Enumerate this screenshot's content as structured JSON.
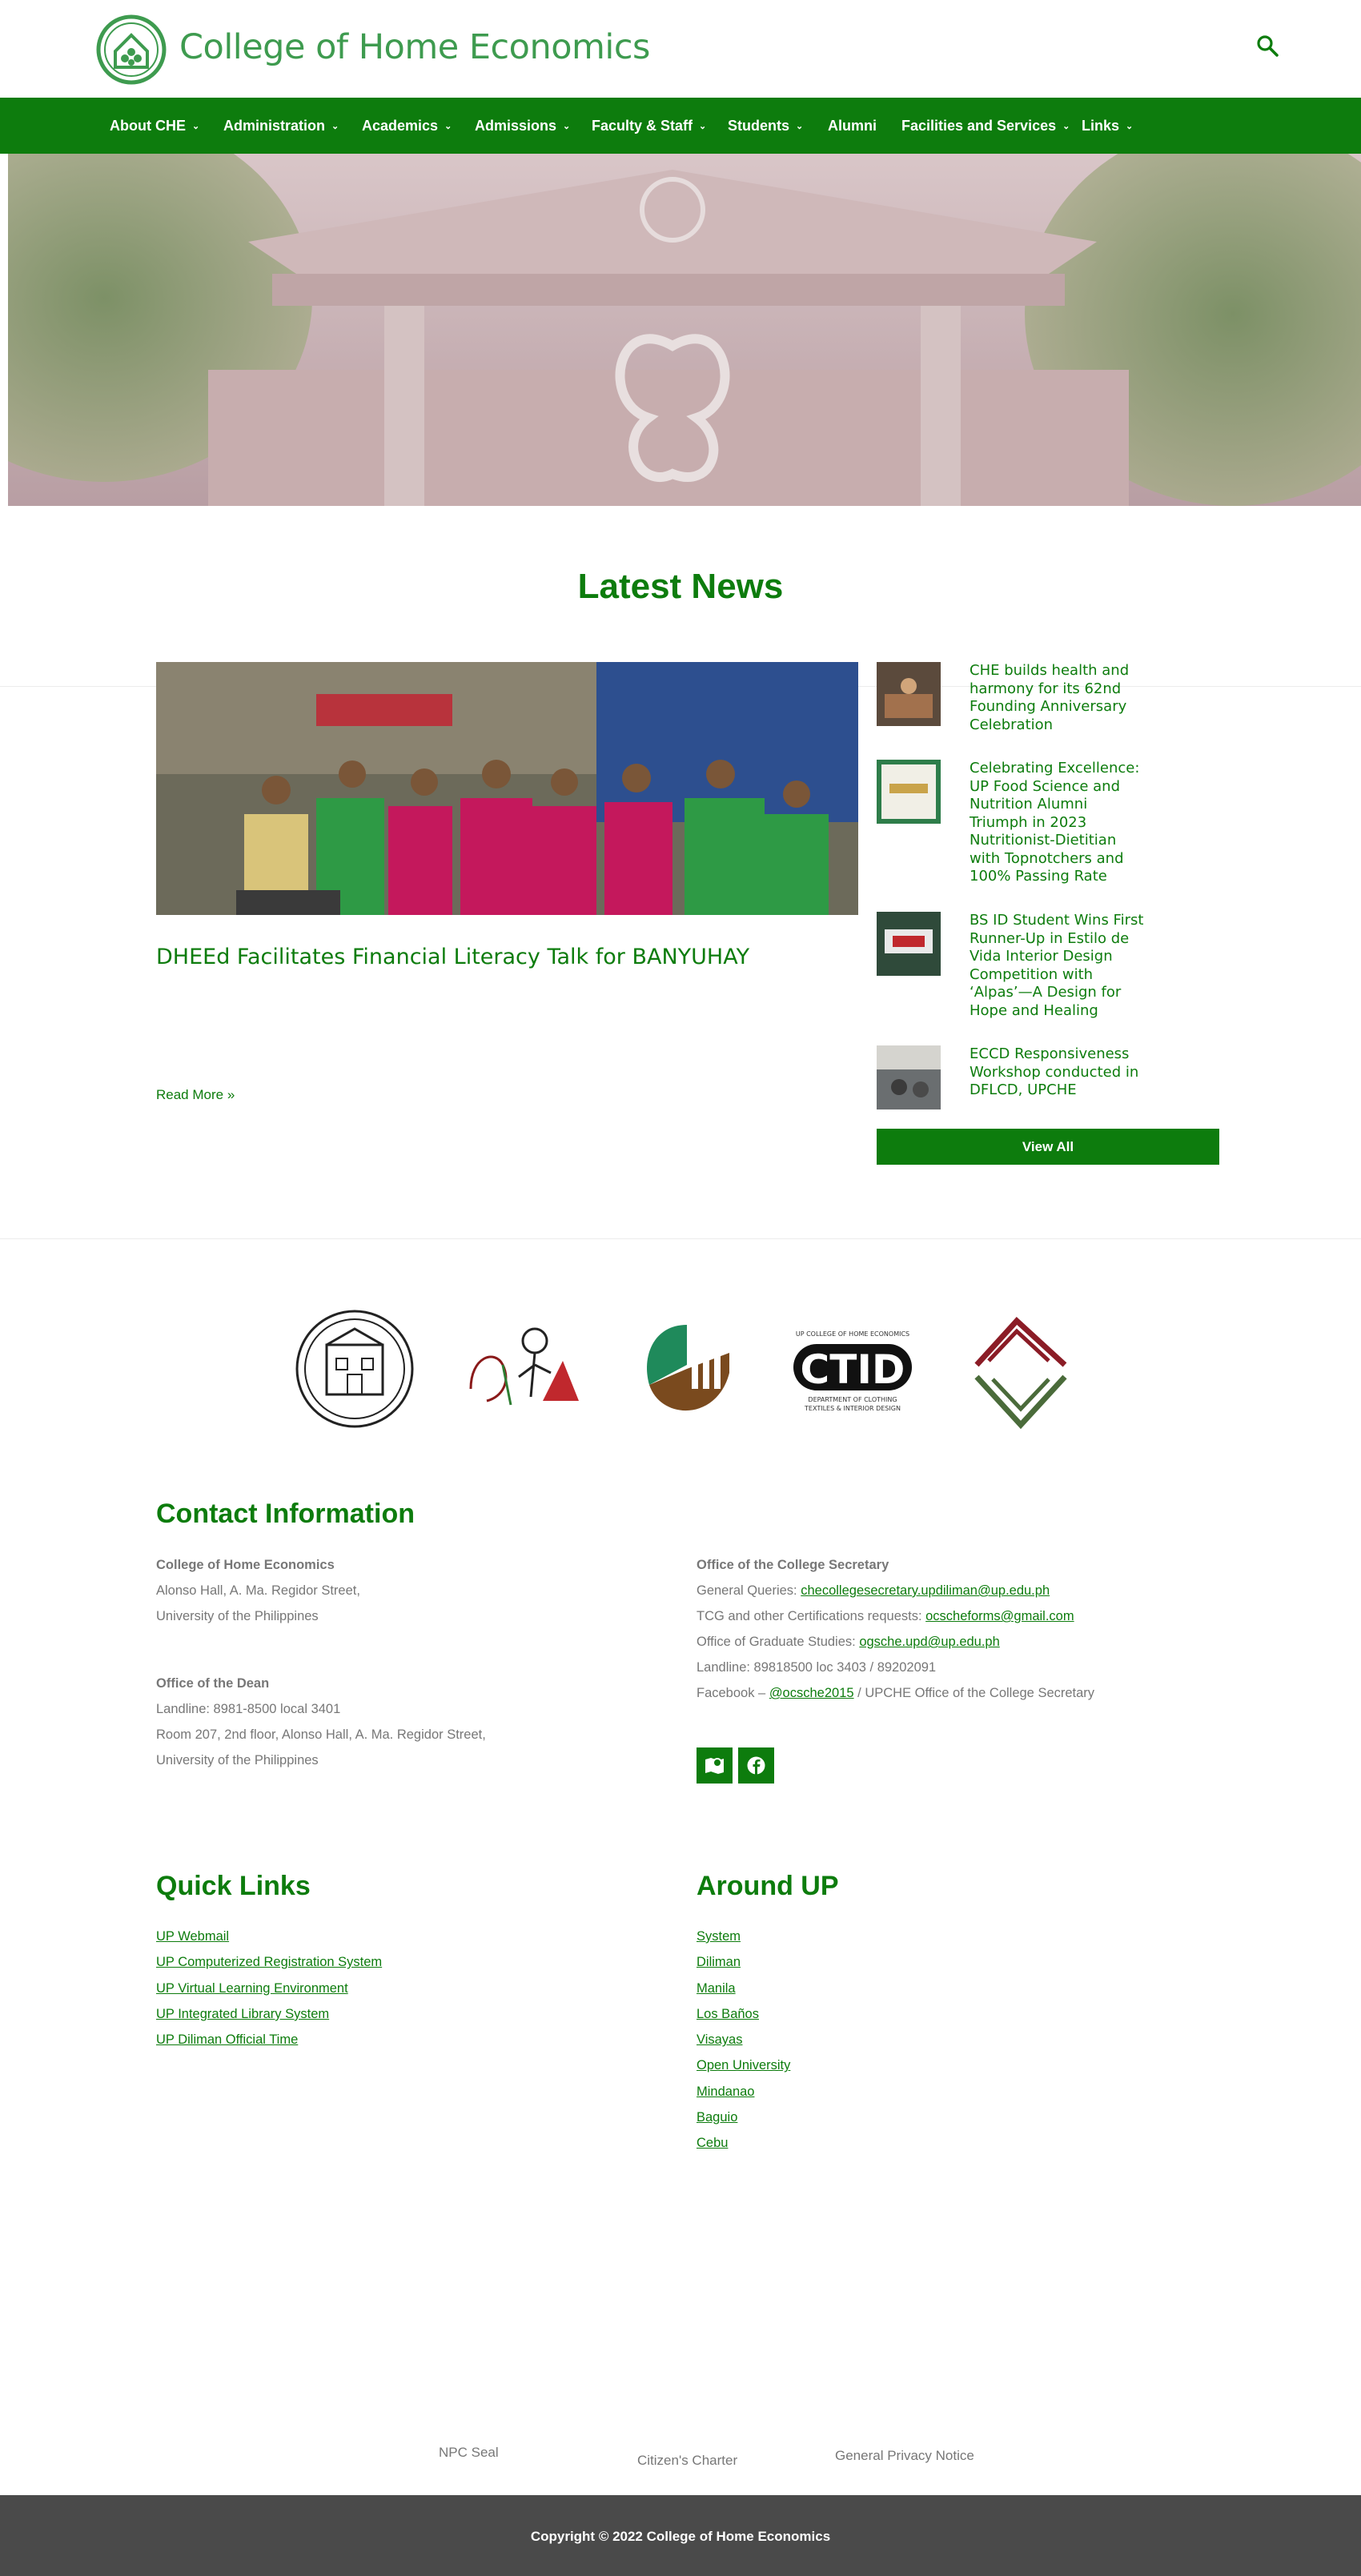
{
  "header": {
    "site_title": "College of Home Economics",
    "logo_icon": "che-logo-icon",
    "search_icon": "search-icon",
    "colors": {
      "brand_green": "#0d7c0d",
      "title_green": "#3e9b4f"
    }
  },
  "nav": {
    "items": [
      {
        "label": "About CHE",
        "has_dropdown": true
      },
      {
        "label": "Administration",
        "has_dropdown": true
      },
      {
        "label": "Academics",
        "has_dropdown": true
      },
      {
        "label": "Admissions",
        "has_dropdown": true
      },
      {
        "label": "Faculty & Staff",
        "has_dropdown": true
      },
      {
        "label": "Students",
        "has_dropdown": true
      },
      {
        "label": "Alumni",
        "has_dropdown": false
      },
      {
        "label": "Facilities and Services",
        "has_dropdown": true
      },
      {
        "label": "Links",
        "has_dropdown": true
      }
    ],
    "chevron": "⌄"
  },
  "news": {
    "heading": "Latest News",
    "featured": {
      "title": "DHEEd Facilitates Financial Literacy Talk for BANYUHAY",
      "read_more": "Read More »"
    },
    "sidebar": [
      {
        "title": "CHE builds health and harmony for its 62nd Founding Anniversary Celebration"
      },
      {
        "title": "Celebrating Excellence: UP Food Science and Nutrition Alumni Triumph in 2023 Nutritionist-Dietitian with Topnotchers and 100% Passing Rate"
      },
      {
        "title": "BS ID Student Wins First Runner-Up in Estilo de Vida Interior Design Competition with ‘Alpas’—A Design for Hope and Healing"
      },
      {
        "title": "ECCD Responsiveness Workshop conducted in DFLCD, UPCHE"
      }
    ],
    "view_all": "View All"
  },
  "dept_logos": {
    "ctid_line1": "UP COLLEGE OF HOME ECONOMICS",
    "ctid_text": "CTID",
    "ctid_line2": "DEPARTMENT OF CLOTHING",
    "ctid_line3": "TEXTILES & INTERIOR DESIGN"
  },
  "contact": {
    "heading": "Contact Information",
    "college": {
      "name": "College of Home Economics",
      "address1": "Alonso Hall, A. Ma. Regidor Street,",
      "address2": "University of the Philippines"
    },
    "dean": {
      "name": "Office of the Dean",
      "landline": "Landline: 8981-8500 local 3401",
      "address1": "Room 207, 2nd floor, Alonso Hall, A. Ma. Regidor Street,",
      "address2": "University of the Philippines"
    },
    "secretary": {
      "name": "Office of the College Secretary",
      "general_label": "General Queries: ",
      "general_email": "checollegesecretary.updiliman@up.edu.ph",
      "tcg_label": "TCG and other Certifications requests: ",
      "tcg_email": "ocscheforms@gmail.com",
      "ogs_label": "Office of Graduate Studies: ",
      "ogs_email": "ogsche.upd@up.edu.ph",
      "landline": "Landline: 89818500 loc 3403 / 89202091",
      "fb_label": "Facebook – ",
      "fb_handle": "@ocsche2015",
      "fb_suffix": " / UPCHE Office of the College Secretary"
    },
    "icons": [
      "map-icon",
      "facebook-icon"
    ]
  },
  "quick_links": {
    "heading": "Quick Links",
    "items": [
      "UP Webmail",
      "UP Computerized Registration System",
      "UP Virtual Learning Environment",
      "UP Integrated Library System",
      "UP Diliman Official Time"
    ]
  },
  "around_up": {
    "heading": "Around UP",
    "items": [
      "System",
      "Diliman",
      "Manila",
      "Los Baños",
      "Visayas",
      "Open University",
      "Mindanao",
      "Baguio",
      "Cebu"
    ]
  },
  "footer": {
    "links": [
      "NPC Seal",
      "Citizen's Charter",
      "General Privacy Notice"
    ],
    "copyright": "Copyright © 2022 College of Home Economics"
  }
}
